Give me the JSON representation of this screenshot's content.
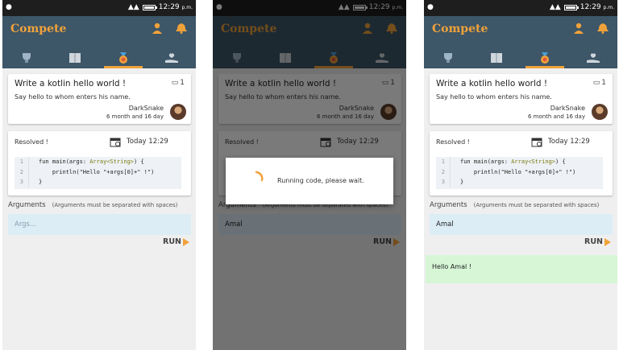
{
  "status_bar": {
    "time": "12:29",
    "ampm": "p.m."
  },
  "app": {
    "title": "Compete"
  },
  "icons": {
    "tabs": [
      "trophy-icon",
      "book-icon",
      "medal-icon",
      "hand-heart-icon"
    ],
    "header": [
      "user-icon",
      "bell-icon"
    ]
  },
  "colors": {
    "accent": "#f0a23a",
    "appbar": "#3d5668",
    "input_bg": "#dcedf6",
    "output_bg": "#d6f6d6"
  },
  "question": {
    "title": "Write a kotlin hello world !",
    "count": "1",
    "description": "Say hello to whom enters his name.",
    "author": "DarkSnake",
    "age": "6 month and 16 day"
  },
  "result": {
    "status": "Resolved !",
    "time": "Today 12:29"
  },
  "code": {
    "line_numbers": [
      "1",
      "2",
      "3"
    ],
    "line1": {
      "a": "fun main(args: ",
      "b": "Array<String>",
      "c": ") {"
    },
    "line2": {
      "a": "println(\"Hello \"+args[0]+\" !\")"
    },
    "line3": "}"
  },
  "arguments": {
    "label": "Arguments",
    "hint": "(Arguments must be separated with spaces)",
    "placeholder": "Args..."
  },
  "run_label": "RUN",
  "screens": {
    "s2": {
      "args_value": "Amal",
      "dialog_message": "Running code, please wait."
    },
    "s3": {
      "args_value": "Amal",
      "output": "Hello Amal !"
    }
  }
}
